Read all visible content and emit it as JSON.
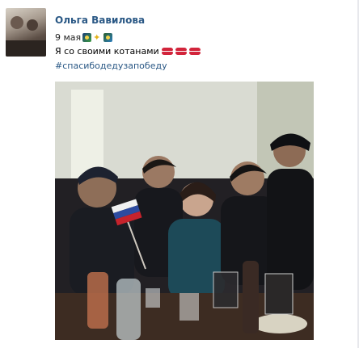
{
  "post": {
    "author": "Ольга Вавилова",
    "date": "9 мая",
    "date_emoji_icons": [
      "fireworks-icon",
      "sparkle-icon",
      "fireworks-icon"
    ],
    "text": "Я со своими котанами",
    "text_emoji_icons": [
      "kiss-lips-icon",
      "kiss-lips-icon",
      "kiss-lips-icon"
    ],
    "hashtag": "#спасибодедузапобеду"
  },
  "colors": {
    "link": "#2a5885",
    "text": "#000000",
    "kiss": "#d2243b"
  }
}
